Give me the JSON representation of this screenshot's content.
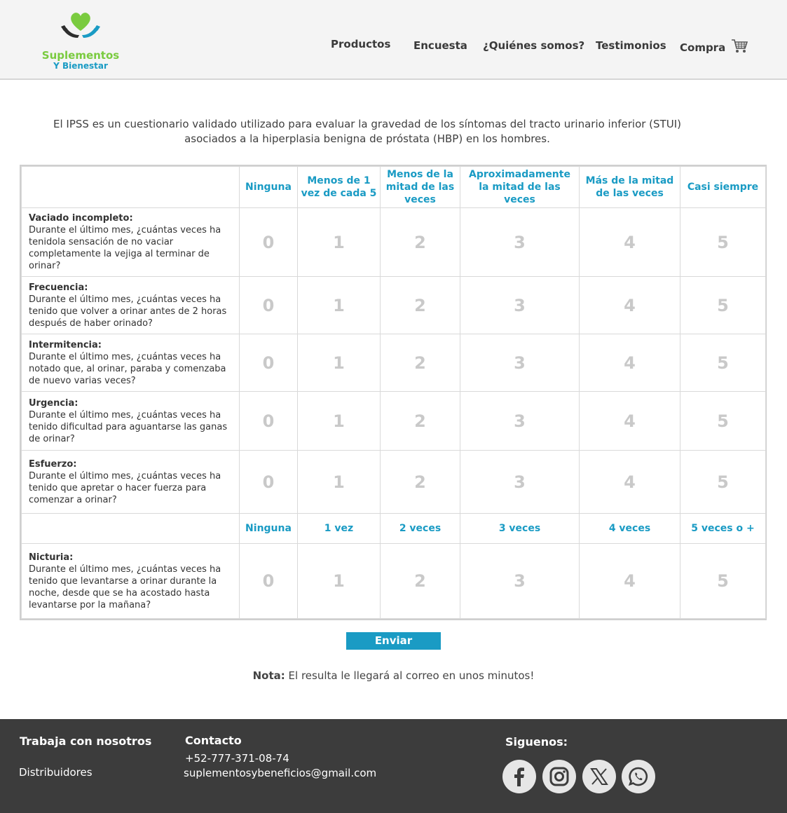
{
  "brand": {
    "line1": "Suplementos",
    "line2": "Y Bienestar",
    "logo_icon": "heart-hands-icon",
    "green": "#7acb3f",
    "blue": "#1a9bc4"
  },
  "nav": {
    "productos": "Productos",
    "encuesta": "Encuesta",
    "quienes": "¿Quiénes somos?",
    "testimonios": "Testimonios",
    "compra": "Compra",
    "cart_icon": "shopping-cart-icon"
  },
  "intro": {
    "line1": "El IPSS es un cuestionario validado utilizado para evaluar la gravedad de los síntomas del tracto urinario inferior (STUI)",
    "line2": "asociados a la hiperplasia benigna de próstata (HBP) en los hombres."
  },
  "table": {
    "headers": [
      "Ninguna",
      "Menos de 1 vez de cada 5",
      "Menos de la mitad de las veces",
      "Aproximadamente la mitad de las veces",
      "Más de la mitad de las veces",
      "Casi siempre"
    ],
    "headers2": [
      "Ninguna",
      "1 vez",
      "2 veces",
      "3 veces",
      "4 veces",
      "5 veces o +"
    ],
    "options": [
      "0",
      "1",
      "2",
      "3",
      "4",
      "5"
    ],
    "questions": [
      {
        "title": "Vaciado incompleto:",
        "text": "Durante el último mes, ¿cuántas veces ha tenidola sensación de no vaciar completamente la vejiga al terminar de orinar?"
      },
      {
        "title": "Frecuencia:",
        "text": "Durante el último mes, ¿cuántas veces ha tenido que volver a orinar antes de 2 horas después de haber orinado?"
      },
      {
        "title": "Intermitencia:",
        "text": "Durante el último mes, ¿cuántas veces ha notado que, al orinar, paraba y comenzaba de nuevo varias veces?"
      },
      {
        "title": "Urgencia:",
        "text": "Durante el último mes, ¿cuántas veces ha tenido dificultad para aguantarse las ganas de orinar?"
      },
      {
        "title": "Esfuerzo:",
        "text": "Durante el último mes, ¿cuántas veces ha tenido que apretar o hacer fuerza para comenzar a orinar?"
      },
      {
        "title": "Nicturia:",
        "text": "Durante el último mes, ¿cuántas veces ha tenido que levantarse a orinar durante la noche, desde que se ha acostado hasta levantarse por la mañana?"
      }
    ]
  },
  "submit_label": "Enviar",
  "note": {
    "label": "Nota:",
    "text": " El resulta le llegará al correo en unos minutos!"
  },
  "footer": {
    "work_title": "Trabaja con nosotros",
    "distributors": "Distribuidores",
    "contact_title": "Contacto",
    "phone": "+52-777-371-08-74",
    "email": "suplementosybeneficios@gmail.com",
    "follow_title": "Siguenos:",
    "social_icons": [
      "facebook-icon",
      "instagram-icon",
      "x-icon",
      "whatsapp-icon"
    ]
  }
}
